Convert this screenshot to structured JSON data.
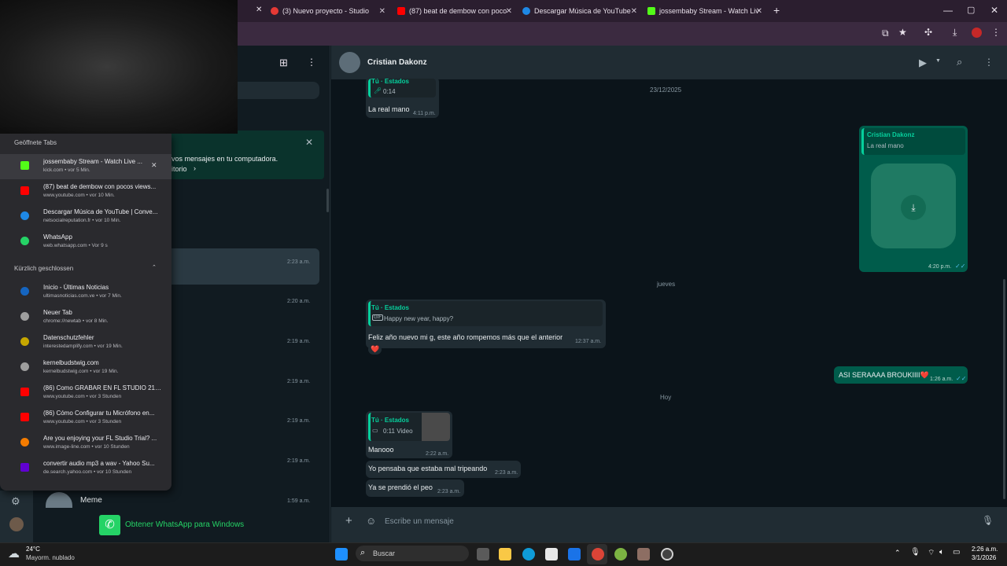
{
  "browser": {
    "tabs": [
      {
        "label": "(3) Nuevo proyecto - Studio",
        "color": "#e53935"
      },
      {
        "label": "(87) beat de dembow con poco",
        "color": "#ff0000"
      },
      {
        "label": "Descargar Música de YouTube",
        "color": "#1e88e5"
      },
      {
        "label": "jossembaby Stream - Watch Liv",
        "color": "#53fc18"
      }
    ],
    "new_tab": "+"
  },
  "wa_left": {
    "banner_line1": "vos mensajes en tu computadora.",
    "banner_line2": "itorio",
    "times": [
      "2:23 a.m.",
      "2:20 a.m.",
      "2:19 a.m.",
      "2:19 a.m.",
      "2:19 a.m.",
      "2:19 a.m.",
      "1:59 a.m."
    ],
    "last_chat_name": "Meme",
    "get_app": "Obtener WhatsApp para Windows"
  },
  "chat": {
    "contact": "Cristian Dakonz",
    "messages": {
      "m1_quote_name": "Tú · Estados",
      "m1_quote_text": "0:14",
      "m1_text": "La real mano",
      "m1_time": "4:11 p.m.",
      "date1": "23/12/2025",
      "m2_quote_name": "Cristian Dakonz",
      "m2_quote_text": "La real mano",
      "m2_time": "4:20 p.m.",
      "date2": "jueves",
      "m3_quote_name": "Tú · Estados",
      "m3_quote_text": "Happy new year, happy?",
      "m3_text": "Feliz año nuevo mi g, este año rompemos más que el anterior",
      "m3_time": "12:37 a.m.",
      "m3_reaction": "❤️",
      "m4_text": "ASI SERAAAA BROUKIIII❤️",
      "m4_time": "1:26 a.m.",
      "date3": "Hoy",
      "m5_quote_name": "Tú · Estados",
      "m5_quote_text": "0:11 Video",
      "m5_text": "Manooo",
      "m5_time": "2:22 a.m.",
      "m6_text": "Yo pensaba que estaba mal tripeando",
      "m6_time": "2:23 a.m.",
      "m7_text": "Ya se prendió el peo",
      "m7_time": "2:23 a.m."
    },
    "composer_placeholder": "Escribe un mensaje"
  },
  "tab_search": {
    "open_header": "Geöffnete Tabs",
    "open_tabs": [
      {
        "title": "jossembaby Stream - Watch Live ...",
        "sub": "kick.com • vor 5 Min.",
        "color": "#53fc18"
      },
      {
        "title": "(87) beat de dembow con pocos views...",
        "sub": "www.youtube.com • vor 10 Min.",
        "color": "#ff0000"
      },
      {
        "title": "Descargar Música de YouTube | Conve...",
        "sub": "netsocialreputation.fr • vor 10 Min.",
        "color": "#1e88e5"
      },
      {
        "title": "WhatsApp",
        "sub": "web.whatsapp.com • Vor 9 s",
        "color": "#25d366"
      }
    ],
    "closed_header": "Kürzlich geschlossen",
    "closed_tabs": [
      {
        "title": "Inicio - Últimas Noticias",
        "sub": "ultimasnoticias.com.ve • vor 7 Min.",
        "color": "#1565c0"
      },
      {
        "title": "Neuer Tab",
        "sub": "chrome://newtab • vor 8 Min.",
        "color": "#9e9e9e"
      },
      {
        "title": "Datenschutzfehler",
        "sub": "interestedamplify.com • vor 19 Min.",
        "color": "#c6a700"
      },
      {
        "title": "kernelbudstwig.com",
        "sub": "kernelbudstwig.com • vor 19 Min.",
        "color": "#9e9e9e"
      },
      {
        "title": "(86) Como GRABAR EN FL STUDIO 21 - ...",
        "sub": "www.youtube.com • vor 3 Stunden",
        "color": "#ff0000"
      },
      {
        "title": "(86) Cómo Configurar tu Micrófono en...",
        "sub": "www.youtube.com • vor 3 Stunden",
        "color": "#ff0000"
      },
      {
        "title": "Are you enjoying your FL Studio Trial? ...",
        "sub": "www.image-line.com • vor 10 Stunden",
        "color": "#f57c00"
      },
      {
        "title": "convertir audio mp3 a wav - Yahoo Su...",
        "sub": "de.search.yahoo.com • vor 10 Stunden",
        "color": "#6001d2"
      }
    ]
  },
  "taskbar": {
    "weather_temp": "24°C",
    "weather_desc": "Mayorm. nublado",
    "search": "Buscar",
    "time": "2:26 a.m.",
    "date": "3/1/2026"
  }
}
